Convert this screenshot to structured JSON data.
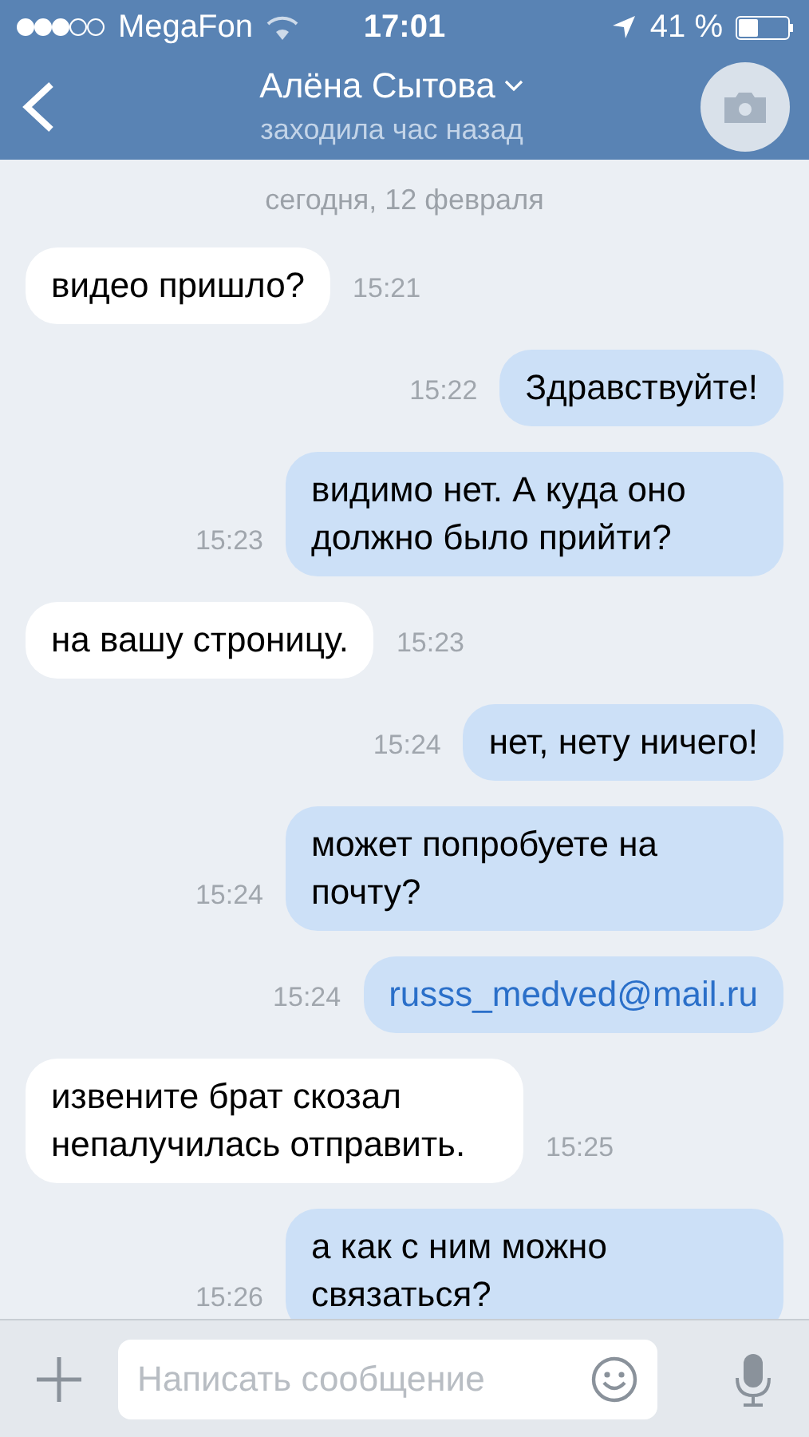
{
  "status_bar": {
    "carrier": "MegaFon",
    "time": "17:01",
    "battery": "41 %"
  },
  "header": {
    "name": "Алёна Сытова",
    "status": "заходила час назад"
  },
  "date": "сегодня, 12 февраля",
  "messages": [
    {
      "kind": "in",
      "text": "видео пришло?",
      "time": "15:21"
    },
    {
      "kind": "out",
      "text": "Здравствуйте!",
      "time": "15:22"
    },
    {
      "kind": "out",
      "text": "видимо нет. А куда оно должно было прийти?",
      "time": "15:23"
    },
    {
      "kind": "in",
      "text": "на вашу строницу.",
      "time": "15:23"
    },
    {
      "kind": "out",
      "text": "нет, нету ничего!",
      "time": "15:24"
    },
    {
      "kind": "out",
      "text": "может попробуете на почту?",
      "time": "15:24"
    },
    {
      "kind": "out",
      "text": "russs_medved@mail.ru",
      "time": "15:24",
      "link": true
    },
    {
      "kind": "in",
      "text": "извените брат скозал непалучилась отправить.",
      "time": "15:25"
    },
    {
      "kind": "out",
      "text": "а как с ним можно связаться?",
      "time": "15:26"
    }
  ],
  "composer": {
    "placeholder": "Написать сообщение"
  }
}
